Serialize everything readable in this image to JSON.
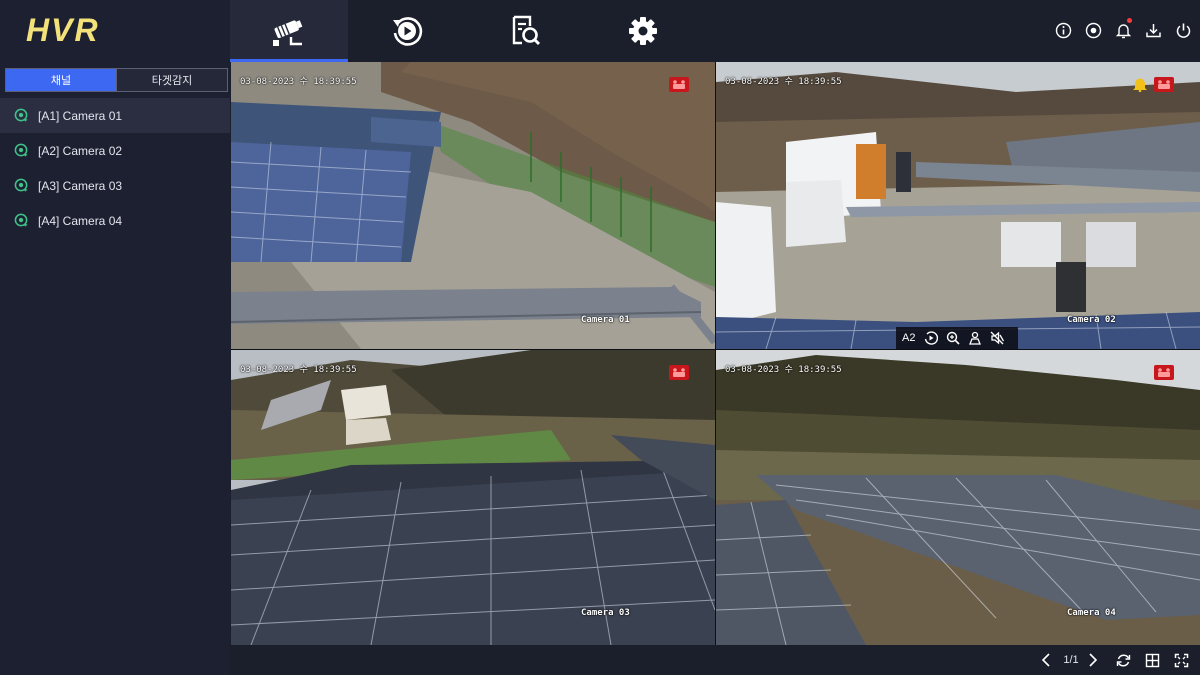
{
  "app": {
    "logo": "HVR"
  },
  "sidebar": {
    "segments": [
      {
        "label": "채널",
        "active": true
      },
      {
        "label": "타겟감지",
        "active": false
      }
    ],
    "cameras": [
      {
        "label": "[A1] Camera 01",
        "selected": true
      },
      {
        "label": "[A2] Camera 02",
        "selected": false
      },
      {
        "label": "[A3] Camera 03",
        "selected": false
      },
      {
        "label": "[A4] Camera 04",
        "selected": false
      }
    ]
  },
  "topbar": {
    "tabs": [
      {
        "icon": "camera-icon",
        "active": true
      },
      {
        "icon": "playback-icon",
        "active": false
      },
      {
        "icon": "search-file-icon",
        "active": false
      },
      {
        "icon": "gear-icon",
        "active": false
      }
    ],
    "right_icons": [
      "info-icon",
      "record-icon",
      "bell-icon",
      "download-icon",
      "power-icon"
    ]
  },
  "grid": {
    "tiles": [
      {
        "timestamp": "03-08-2023 수 18:39:55",
        "name": "Camera 01",
        "selected": false,
        "bell": false
      },
      {
        "timestamp": "03-08-2023 수 18:39:55",
        "name": "Camera 02",
        "selected": false,
        "bell": true
      },
      {
        "timestamp": "03-08-2023 수 18:39:55",
        "name": "Camera 03",
        "selected": true,
        "bell": false
      },
      {
        "timestamp": "03-08-2023 수 18:39:55",
        "name": "Camera 04",
        "selected": false,
        "bell": false
      }
    ],
    "toolbar": {
      "channel": "A2",
      "icons": [
        "instant-playback-icon",
        "zoom-icon",
        "person-icon",
        "mute-icon"
      ]
    }
  },
  "bottombar": {
    "page": "1/1"
  },
  "colors": {
    "accent": "#3d68f2",
    "rec": "#c8171c",
    "logo": "#f3e27a"
  }
}
